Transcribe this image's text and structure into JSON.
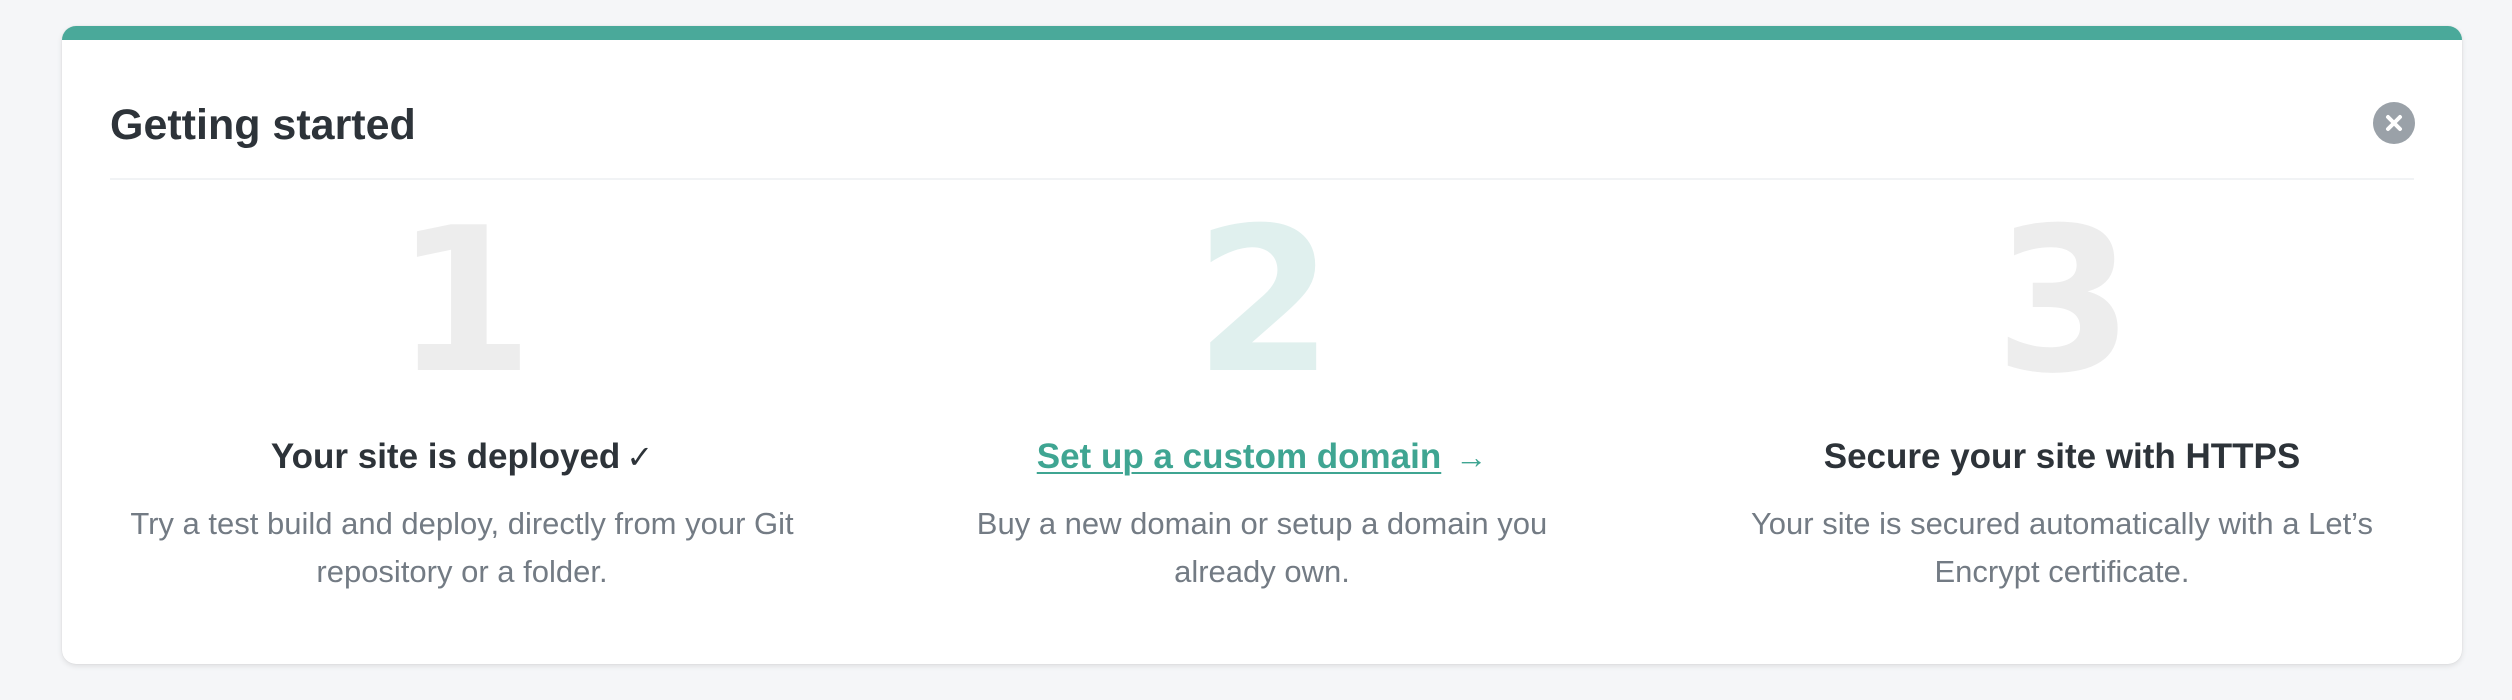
{
  "card": {
    "title": "Getting started",
    "accent_color": "#4aa99a",
    "close_icon": "close-icon"
  },
  "steps": [
    {
      "number": "1",
      "title": "Your site is deployed",
      "status_icon": "checkmark-icon",
      "status_glyph": "✓",
      "desc_line1": "Try a test build and deploy, directly from your Git",
      "desc_line2": "repository or a folder."
    },
    {
      "number": "2",
      "title": "Set up a custom domain",
      "link_color": "#3fa592",
      "arrow_icon": "arrow-right-icon",
      "arrow_glyph": "→",
      "desc_line1": "Buy a new domain or setup a domain you",
      "desc_line2": "already own."
    },
    {
      "number": "3",
      "title": "Secure your site with HTTPS",
      "desc_line1": "Your site is secured automatically with a Let’s",
      "desc_line2": "Encrypt certificate."
    }
  ]
}
